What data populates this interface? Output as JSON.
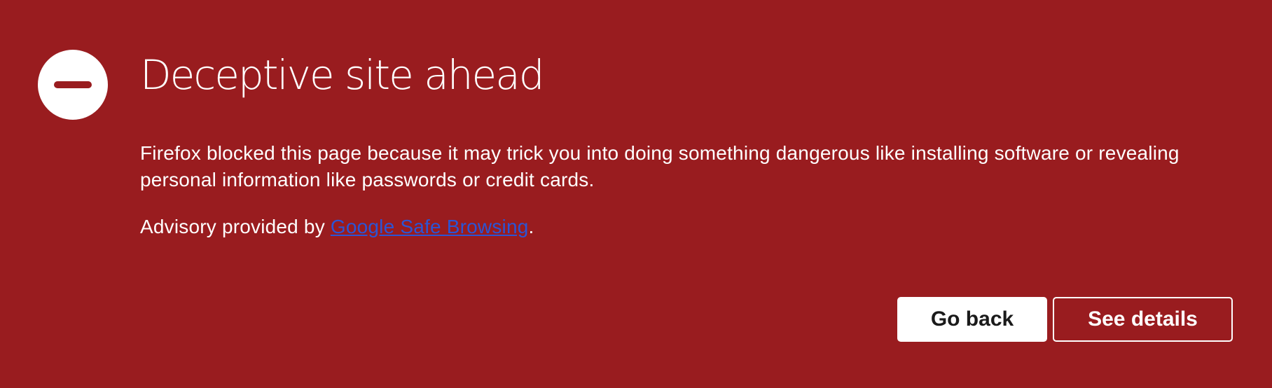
{
  "colors": {
    "background": "#991c1f",
    "text": "#ffffff",
    "link": "#2a55d6",
    "primary_button_bg": "#ffffff",
    "primary_button_text": "#1a1a1a"
  },
  "icon": {
    "name": "blocked-icon"
  },
  "error": {
    "title": "Deceptive site ahead",
    "description": "Firefox blocked this page because it may trick you into doing something dangerous like installing software or revealing personal information like passwords or credit cards.",
    "advisory_prefix": "Advisory provided by ",
    "advisory_link": "Google Safe Browsing",
    "advisory_suffix": "."
  },
  "buttons": {
    "go_back": "Go back",
    "see_details": "See details"
  }
}
